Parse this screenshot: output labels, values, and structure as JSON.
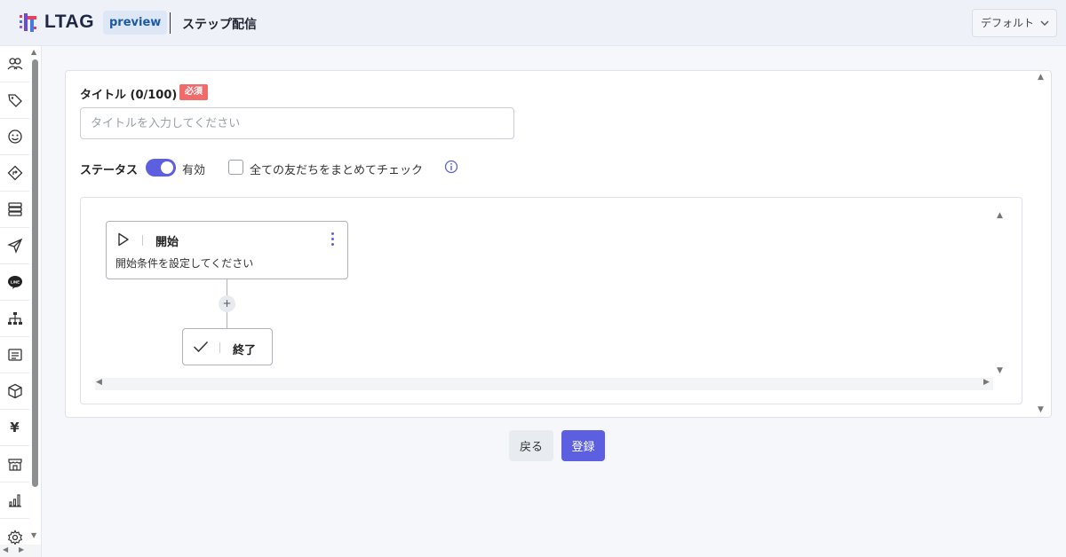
{
  "header": {
    "logo_text": "LTAG",
    "preview_label": "preview",
    "page_title": "ステップ配信",
    "account_select": "デフォルト"
  },
  "sidebar": {
    "items": [
      {
        "icon": "users-icon"
      },
      {
        "icon": "tag-icon"
      },
      {
        "icon": "smile-icon"
      },
      {
        "icon": "route-icon"
      },
      {
        "icon": "database-icon"
      },
      {
        "icon": "send-icon"
      },
      {
        "icon": "line-icon"
      },
      {
        "icon": "hierarchy-icon"
      },
      {
        "icon": "form-icon"
      },
      {
        "icon": "box-icon"
      },
      {
        "icon": "yen-icon"
      },
      {
        "icon": "store-icon"
      },
      {
        "icon": "chart-icon"
      },
      {
        "icon": "gear-icon"
      }
    ],
    "yen_glyph": "¥",
    "line_glyph": "LINE"
  },
  "form": {
    "title_label": "タイトル (0/100)",
    "required_badge": "必須",
    "title_value": "",
    "title_placeholder": "タイトルを入力してください",
    "status_label": "ステータス",
    "status_enabled": true,
    "status_value": "有効",
    "check_all_checked": false,
    "check_all_label": "全ての友だちをまとめてチェック"
  },
  "flow": {
    "start_title": "開始",
    "start_description": "開始条件を設定してください",
    "add_symbol": "+",
    "end_title": "終了"
  },
  "actions": {
    "back_label": "戻る",
    "register_label": "登録"
  },
  "colors": {
    "accent": "#5b5fe0",
    "required": "#f26b6b",
    "badge_bg": "#dde7f6",
    "badge_text": "#1c5aa6"
  }
}
